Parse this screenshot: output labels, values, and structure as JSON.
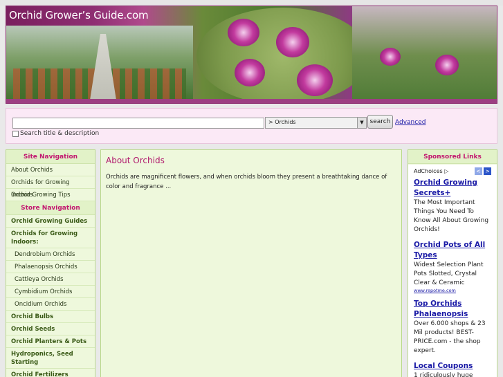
{
  "header": {
    "site_title": "Orchid Grower’s Guide.com"
  },
  "search": {
    "input_value": "",
    "category_selected": "> Orchids",
    "button_label": "search",
    "advanced_label": "Advanced",
    "checkbox_label": "Search title & description"
  },
  "site_nav": {
    "heading": "Site Navigation",
    "items": [
      {
        "label": "About Orchids"
      },
      {
        "label": "Orchids for Growing Indoors"
      },
      {
        "label": "Orchid Growing Tips"
      }
    ]
  },
  "store_nav": {
    "heading": "Store Navigation",
    "items": [
      {
        "label": "Orchid Growing Guides"
      },
      {
        "label": "Orchids for Growing Indoors:"
      },
      {
        "label": "Dendrobium Orchids"
      },
      {
        "label": "Phalaenopsis Orchids"
      },
      {
        "label": "Cattleya Orchids"
      },
      {
        "label": "Cymbidium Orchids"
      },
      {
        "label": "Oncidium Orchids"
      },
      {
        "label": "Orchid Bulbs"
      },
      {
        "label": "Orchid Seeds"
      },
      {
        "label": "Orchid Planters & Pots"
      },
      {
        "label": "Hydroponics, Seed Starting"
      },
      {
        "label": "Orchid Fertilizers"
      }
    ]
  },
  "main": {
    "title": "About Orchids",
    "text": "Orchids are magnificent flowers, and when orchids bloom they present a breathtaking dance of color and fragrance ..."
  },
  "sponsored": {
    "heading": "Sponsored Links",
    "adchoices_label": "AdChoices",
    "nav_color": "#2b55c9",
    "ads": [
      {
        "title": "Orchid Growing Secrets+",
        "desc": "The Most Important Things You Need To Know All About Growing Orchids!",
        "url": ""
      },
      {
        "title": "Orchid Pots of All Types",
        "desc": "Widest Selection Plant Pots Slotted, Crystal Clear & Ceramic",
        "url": "www.repotme.com"
      },
      {
        "title": "Top Orchids Phalaenopsis",
        "desc": "Over 6.000 shops & 23 Mil products! BEST-PRICE.com - the shop expert.",
        "url": ""
      },
      {
        "title": "Local Coupons",
        "desc": "1 ridiculously huge",
        "url": ""
      }
    ]
  }
}
